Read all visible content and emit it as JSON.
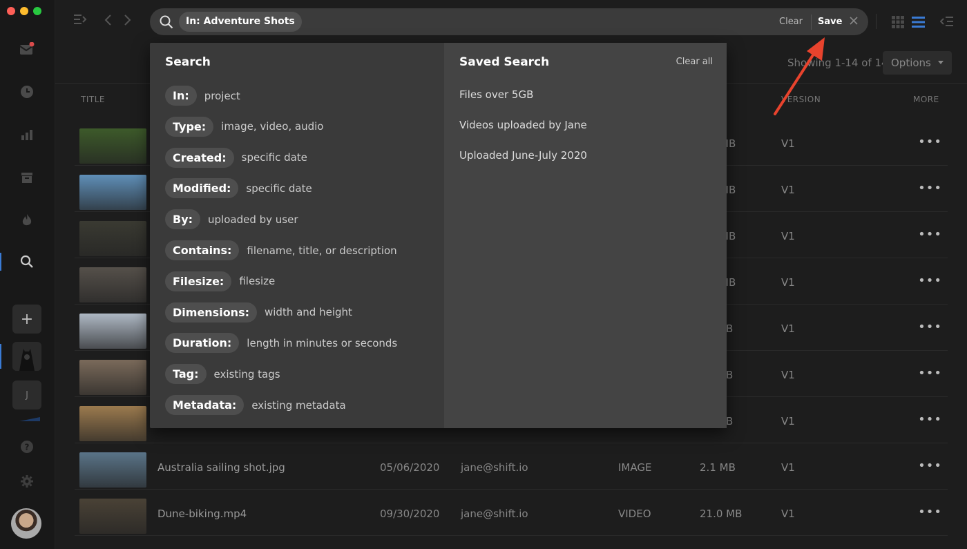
{
  "search": {
    "chip_label": "In: Adventure Shots",
    "clear_label": "Clear",
    "save_label": "Save"
  },
  "list_info": {
    "showing": "Showing 1-14 of 14",
    "options_label": "Options"
  },
  "table": {
    "headers": {
      "title": "TITLE",
      "version": "VERSION",
      "more": "MORE"
    },
    "rows": [
      {
        "title": "",
        "date": "",
        "user": "",
        "type": "",
        "size": "MB",
        "version": "V1",
        "thumb": "#3d5a2a"
      },
      {
        "title": "",
        "date": "",
        "user": "",
        "type": "",
        "size": "MB",
        "version": "V1",
        "thumb": "#5f8fb8"
      },
      {
        "title": "",
        "date": "",
        "user": "",
        "type": "",
        "size": "MB",
        "version": "V1",
        "thumb": "#3a3a32"
      },
      {
        "title": "",
        "date": "",
        "user": "",
        "type": "",
        "size": "MB",
        "version": "V1",
        "thumb": "#55504a"
      },
      {
        "title": "",
        "date": "",
        "user": "",
        "type": "",
        "size": "B",
        "version": "V1",
        "thumb": "#aeb8c4"
      },
      {
        "title": "",
        "date": "",
        "user": "",
        "type": "",
        "size": "B",
        "version": "V1",
        "thumb": "#7a6a5a"
      },
      {
        "title": "",
        "date": "",
        "user": "",
        "type": "",
        "size": "B",
        "version": "V1",
        "thumb": "#9b7a4e"
      },
      {
        "title": "Australia sailing shot.jpg",
        "date": "05/06/2020",
        "user": "jane@shift.io",
        "type": "IMAGE",
        "size": "2.1 MB",
        "version": "V1",
        "thumb": "#5a7488"
      },
      {
        "title": "Dune-biking.mp4",
        "date": "09/30/2020",
        "user": "jane@shift.io",
        "type": "VIDEO",
        "size": "21.0 MB",
        "version": "V1",
        "thumb": "#4a4236"
      }
    ]
  },
  "dropdown": {
    "search_title": "Search",
    "filters": [
      {
        "key": "In:",
        "hint": "project"
      },
      {
        "key": "Type:",
        "hint": "image, video, audio"
      },
      {
        "key": "Created:",
        "hint": "specific date"
      },
      {
        "key": "Modified:",
        "hint": "specific date"
      },
      {
        "key": "By:",
        "hint": "uploaded by user"
      },
      {
        "key": "Contains:",
        "hint": "filename, title, or description"
      },
      {
        "key": "Filesize:",
        "hint": "filesize"
      },
      {
        "key": "Dimensions:",
        "hint": "width and height"
      },
      {
        "key": "Duration:",
        "hint": "length in minutes or seconds"
      },
      {
        "key": "Tag:",
        "hint": "existing tags"
      },
      {
        "key": "Metadata:",
        "hint": "existing metadata"
      }
    ],
    "saved_title": "Saved Search",
    "clear_all_label": "Clear all",
    "saved": [
      "Files over 5GB",
      "Videos uploaded by Jane",
      "Uploaded June-July 2020"
    ]
  },
  "sidebar": {
    "project_initial": "J",
    "add_label": "+"
  },
  "colors": {
    "accent": "#3a7bd5",
    "annotation_arrow": "#e8432d"
  }
}
